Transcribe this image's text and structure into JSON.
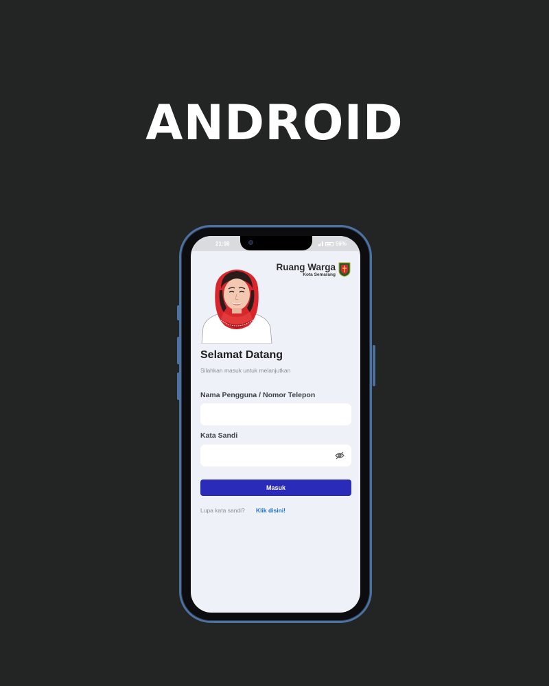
{
  "headline": "ANDROID",
  "status_bar": {
    "time": "21:08",
    "battery": "59%"
  },
  "brand": {
    "title": "Ruang Warga",
    "subtitle": "Kota Semarang"
  },
  "login": {
    "welcome_title": "Selamat Datang",
    "welcome_subtitle": "Silahkan masuk untuk melanjutkan",
    "username_label": "Nama Pengguna / Nomor Telepon",
    "username_value": "",
    "password_label": "Kata Sandi",
    "password_value": "",
    "submit_label": "Masuk",
    "forgot_text": "Lupa kata sandi?",
    "forgot_link": "Klik disini!"
  },
  "colors": {
    "background": "#232424",
    "phone_frame": "#4d72a0",
    "screen_bg": "#eef2f8",
    "primary_button": "#2a2bb8",
    "link": "#1e6fd9",
    "hijab_red": "#d9262c"
  },
  "icons": [
    "eye-slash-icon",
    "battery-icon",
    "signal-icon",
    "city-emblem-icon",
    "camera-icon"
  ]
}
